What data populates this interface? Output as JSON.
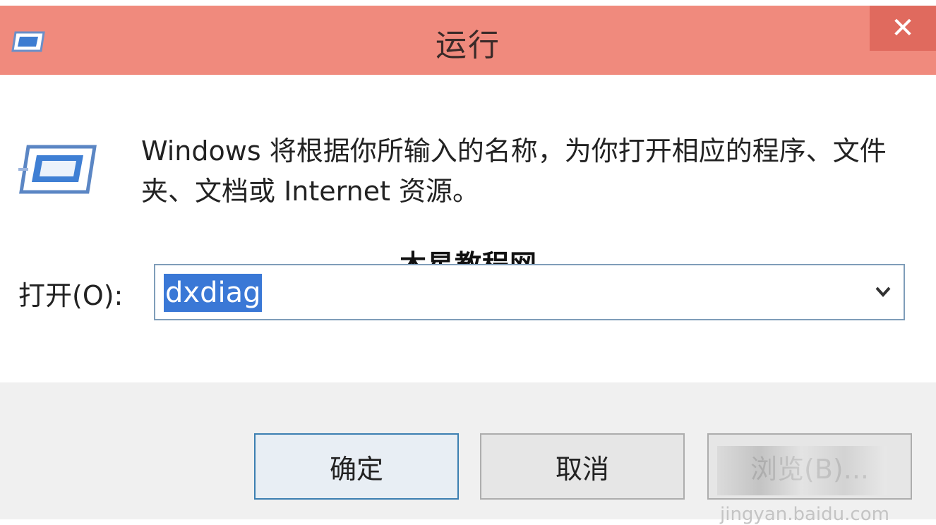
{
  "window": {
    "title": "运行",
    "close_glyph": "✕",
    "icon": "run-dialog-icon"
  },
  "content": {
    "description": "Windows 将根据你所输入的名称，为你打开相应的程序、文件夹、文档或 Internet 资源。",
    "watermark": "木星教程网",
    "open_label": "打开(O):",
    "combo_value": "dxdiag",
    "dropdown_icon": "chevron-down-icon"
  },
  "buttons": {
    "ok": "确定",
    "cancel": "取消",
    "browse": "浏览(B)..."
  },
  "footer": {
    "watermark": "jingyan.baidu.com"
  },
  "colors": {
    "titlebar": "#f08a7d",
    "close": "#e06a5e",
    "selection": "#3a78d6",
    "focus_border": "#3c7fb1"
  }
}
